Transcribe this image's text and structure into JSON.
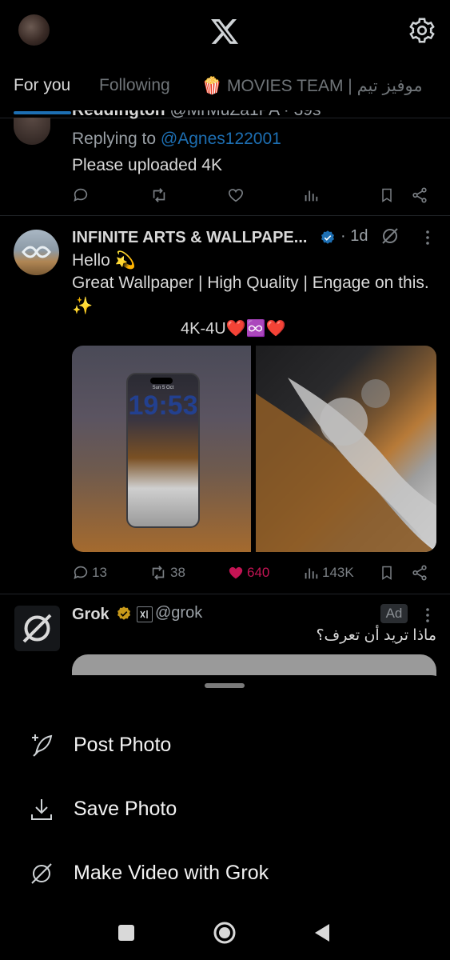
{
  "tabs": [
    "For you",
    "Following",
    "🍿 MOVIES TEAM | موفيز تيم"
  ],
  "tweet1": {
    "name_partial": "Reddington",
    "handle_partial": "@MrMuZa1PA · 39s",
    "replying_prefix": "Replying to",
    "replying_handle": "@Agnes122001",
    "text": "Please uploaded 4K"
  },
  "tweet2": {
    "name": "INFINITE ARTS & WALLPAPE...",
    "time": "· 1d",
    "line1": "Hello 💫",
    "line2": "Great Wallpaper | High Quality | Engage on this.",
    "line3": "✨",
    "line4": "4K-4U❤️♾️❤️",
    "replies": "13",
    "reposts": "38",
    "likes": "640",
    "views": "143K",
    "phone_date": "Sun 5 Oct",
    "phone_time": "19:53"
  },
  "tweet3": {
    "name": "Grok",
    "handle": "@grok",
    "ad_label": "Ad",
    "text": "ماذا تريد أن تعرف؟"
  },
  "sheet": {
    "items": [
      {
        "label": "Post Photo",
        "icon": "feather-plus-icon"
      },
      {
        "label": "Save Photo",
        "icon": "download-icon"
      },
      {
        "label": "Make Video with Grok",
        "icon": "grok-icon"
      }
    ]
  },
  "colors": {
    "accent": "#1d6fb3",
    "like_active": "#c41454",
    "background": "#000000"
  }
}
